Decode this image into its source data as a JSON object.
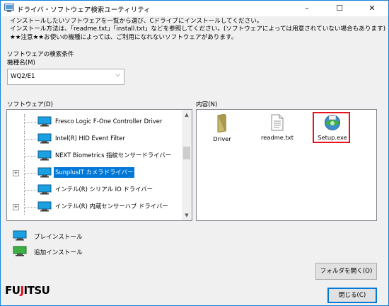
{
  "window": {
    "title": "ドライバ・ソフトウェア検索ユーティリティ",
    "controls": [
      "–",
      "☐",
      "✕"
    ]
  },
  "info": {
    "line1": "インストールしたいソフトウェアを一覧から選び、Cドライブにインストールしてください。",
    "line2": "インストール方法は、「readme.txt」「install.txt」などを参照してください。(ソフトウェアによっては用意されていない場合もあります)",
    "line3": "★★注意★★お使いの機種によっては、ご利用になれないソフトウェアがあります。"
  },
  "search": {
    "section_label": "ソフトウェアの検索条件",
    "model_label": "機種名(M)",
    "model_value": "WQ2/E1"
  },
  "software": {
    "label": "ソフトウェア(D)",
    "items": [
      {
        "label": "Fresco Logic F-One Controller Driver",
        "selected": false,
        "expandable": false
      },
      {
        "label": "Intel(R) HID Event Filter",
        "selected": false,
        "expandable": false
      },
      {
        "label": "NEXT Biometrics 指紋センサードライバー",
        "selected": false,
        "expandable": false
      },
      {
        "label": "SunplusIT カメラドライバー",
        "selected": true,
        "expandable": true
      },
      {
        "label": "インテル(R) シリアル IO ドライバー",
        "selected": false,
        "expandable": false
      },
      {
        "label": "インテル(R) 内蔵センサーハブ ドライバー",
        "selected": false,
        "expandable": true
      }
    ]
  },
  "contents": {
    "label": "内容(N)",
    "files": [
      {
        "name": "Driver",
        "icon": "folder-icon"
      },
      {
        "name": "readme.txt",
        "icon": "text-file-icon"
      },
      {
        "name": "Setup.exe",
        "icon": "setup-exe-icon"
      }
    ]
  },
  "legend": {
    "preinstall": "プレインストール",
    "additional": "追加インストール"
  },
  "buttons": {
    "open_folder": "フォルダを開く(O)",
    "close": "閉じる(C)"
  },
  "logo": {
    "text_a": "FU",
    "text_j": "J",
    "text_b": "ITSU"
  },
  "colors": {
    "selection": "#0078d7",
    "highlight": "#e8141b",
    "brand_red": "#e60012",
    "preinstall_icon": "#1ba1e2",
    "additional_icon": "#3cb043"
  }
}
